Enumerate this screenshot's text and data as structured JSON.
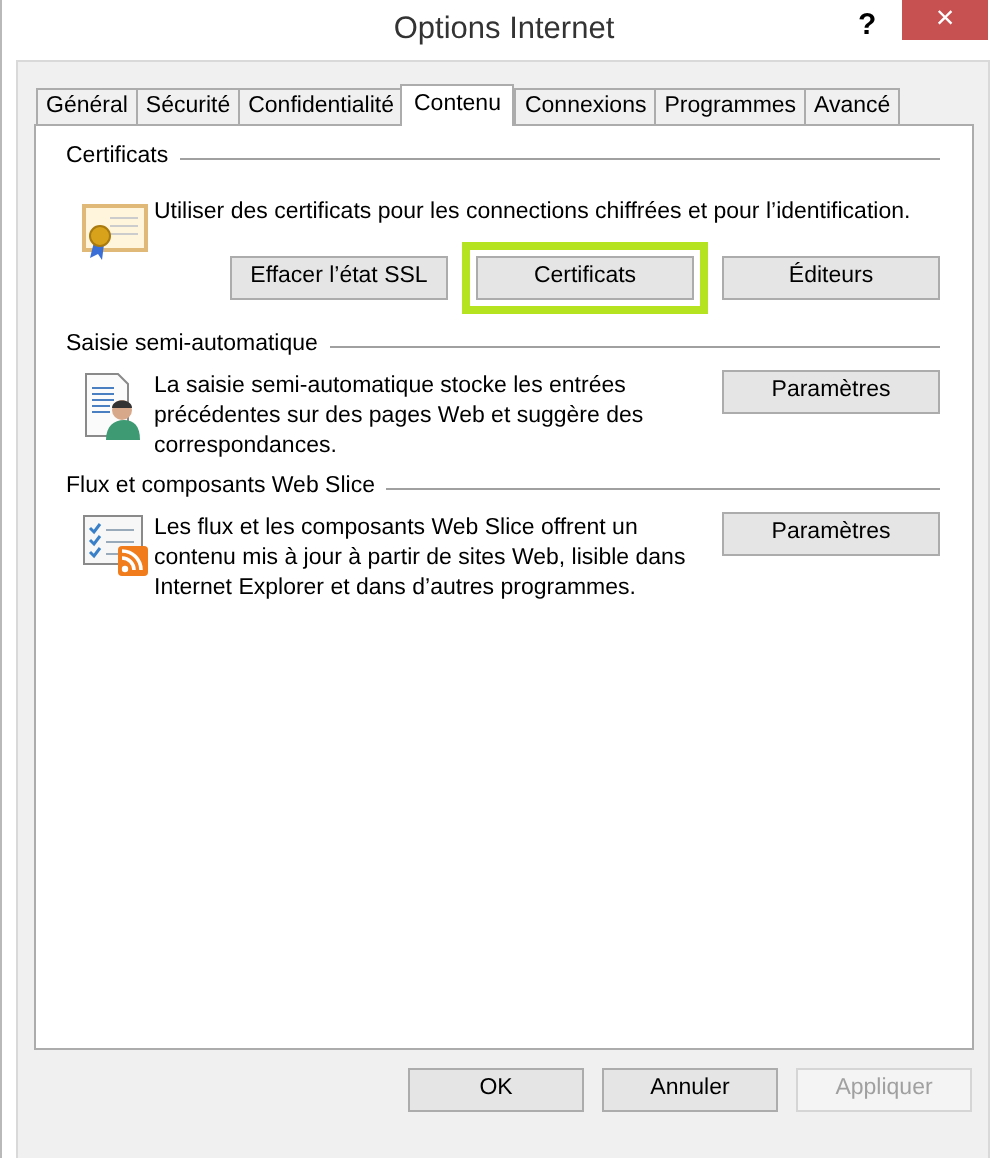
{
  "window": {
    "title": "Options Internet",
    "help": "?",
    "close": "×"
  },
  "tabs": [
    {
      "label": "Général",
      "selected": false
    },
    {
      "label": "Sécurité",
      "selected": false
    },
    {
      "label": "Confidentialité",
      "selected": false
    },
    {
      "label": "Contenu",
      "selected": true
    },
    {
      "label": "Connexions",
      "selected": false
    },
    {
      "label": "Programmes",
      "selected": false
    },
    {
      "label": "Avancé",
      "selected": false
    }
  ],
  "sections": [
    {
      "title": "Certificats",
      "text": "Utiliser des certificats pour les connections chiffrées et pour l’identification.",
      "buttons": [
        {
          "label": "Effacer l’état SSL",
          "highlighted": false
        },
        {
          "label": "Certificats",
          "highlighted": true
        },
        {
          "label": "Éditeurs",
          "highlighted": false
        }
      ]
    },
    {
      "title": "Saisie semi-automatique",
      "text": "La saisie semi-automatique stocke les entrées précédentes sur des pages Web et suggère des correspondances.",
      "buttons": [
        {
          "label": "Paramètres",
          "highlighted": false
        }
      ]
    },
    {
      "title": "Flux et composants Web Slice",
      "text": "Les flux et les composants Web Slice offrent un contenu mis à jour à partir de sites Web, lisible dans Internet Explorer et dans d’autres programmes.",
      "buttons": [
        {
          "label": "Paramètres",
          "highlighted": false
        }
      ]
    }
  ],
  "footer_buttons": [
    {
      "label": "OK",
      "disabled": false
    },
    {
      "label": "Annuler",
      "disabled": false
    },
    {
      "label": "Appliquer",
      "disabled": true
    }
  ]
}
